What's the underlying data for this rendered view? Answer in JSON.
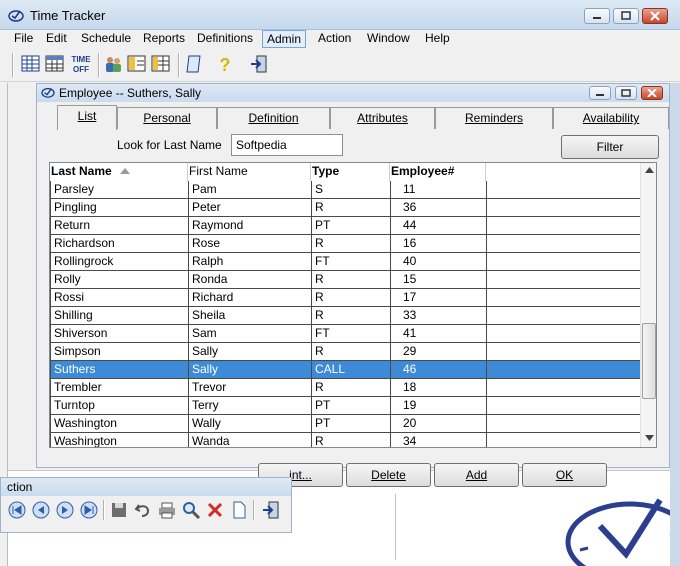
{
  "app": {
    "title": "Time Tracker"
  },
  "menu": [
    "File",
    "Edit",
    "Schedule",
    "Reports",
    "Definitions",
    "Admin",
    "Action",
    "Window",
    "Help"
  ],
  "toolbar": {
    "time_off_label_1": "TIME",
    "time_off_label_2": "OFF"
  },
  "employee_window": {
    "title": "Employee -- Suthers, Sally",
    "tabs": [
      "List",
      "Personal",
      "Definition",
      "Attributes",
      "Reminders",
      "Availability"
    ],
    "look_label": "Look for Last Name",
    "look_value": "Softpedia",
    "filter_label": "Filter",
    "columns": [
      "Last Name",
      "First Name",
      "Type",
      "Employee#"
    ],
    "rows": [
      [
        "Parsley",
        "Pam",
        "S",
        "11"
      ],
      [
        "Pingling",
        "Peter",
        "R",
        "36"
      ],
      [
        "Return",
        "Raymond",
        "PT",
        "44"
      ],
      [
        "Richardson",
        "Rose",
        "R",
        "16"
      ],
      [
        "Rollingrock",
        "Ralph",
        "FT",
        "40"
      ],
      [
        "Rolly",
        "Ronda",
        "R",
        "15"
      ],
      [
        "Rossi",
        "Richard",
        "R",
        "17"
      ],
      [
        "Shilling",
        "Sheila",
        "R",
        "33"
      ],
      [
        "Shiverson",
        "Sam",
        "FT",
        "41"
      ],
      [
        "Simpson",
        "Sally",
        "R",
        "29"
      ],
      [
        "Suthers",
        "Sally",
        "CALL",
        "46"
      ],
      [
        "Trembler",
        "Trevor",
        "R",
        "18"
      ],
      [
        "Turntop",
        "Terry",
        "PT",
        "19"
      ],
      [
        "Washington",
        "Wally",
        "PT",
        "20"
      ],
      [
        "Washington",
        "Wanda",
        "R",
        "34"
      ]
    ],
    "selected_row": 10,
    "buttons": {
      "print": "int...",
      "delete": "Delete",
      "add": "Add",
      "ok": "OK"
    }
  },
  "action_palette": {
    "title": "ction"
  },
  "colors": {
    "selection": "#3d8ad6",
    "titlebar": "#c9dbee",
    "close": "#c9452a"
  }
}
